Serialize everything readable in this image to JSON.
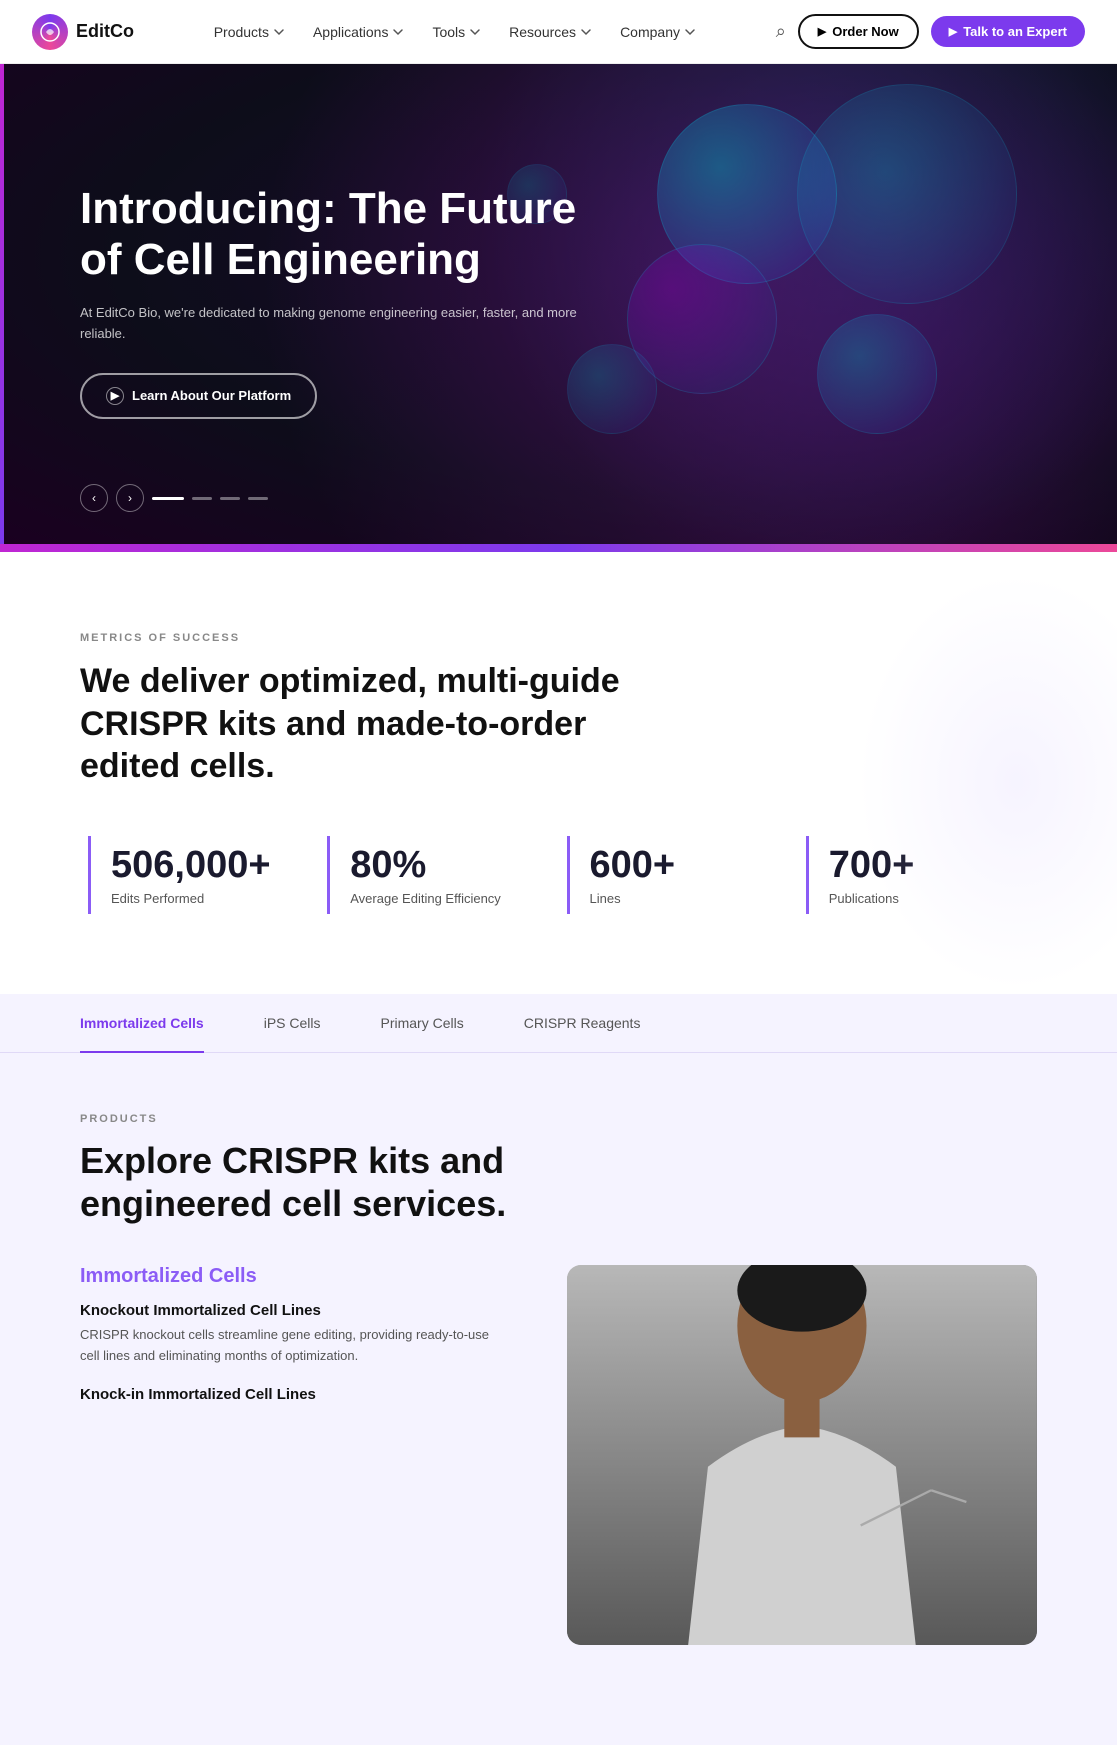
{
  "nav": {
    "logo_text": "EditCo",
    "links": [
      {
        "label": "Products",
        "has_dropdown": true
      },
      {
        "label": "Applications",
        "has_dropdown": true
      },
      {
        "label": "Tools",
        "has_dropdown": true
      },
      {
        "label": "Resources",
        "has_dropdown": true
      },
      {
        "label": "Company",
        "has_dropdown": true
      }
    ],
    "btn_order": "Order Now",
    "btn_expert": "Talk to an Expert"
  },
  "hero": {
    "title": "Introducing: The Future of Cell Engineering",
    "description": "At EditCo Bio, we're dedicated to making genome engineering easier, faster, and more reliable.",
    "cta_label": "Learn About Our Platform",
    "dots_count": 4
  },
  "metrics": {
    "section_label": "METRICS OF SUCCESS",
    "heading": "We deliver optimized, multi-guide CRISPR kits and made-to-order edited cells.",
    "items": [
      {
        "value": "506,000+",
        "description": "Edits Performed"
      },
      {
        "value": "80%",
        "description": "Average Editing Efficiency"
      },
      {
        "value": "600+",
        "description": "Lines"
      },
      {
        "value": "700+",
        "description": "Publications"
      }
    ]
  },
  "tabs": {
    "items": [
      {
        "label": "Immortalized Cells",
        "active": true
      },
      {
        "label": "iPS Cells",
        "active": false
      },
      {
        "label": "Primary Cells",
        "active": false
      },
      {
        "label": "CRISPR Reagents",
        "active": false
      }
    ]
  },
  "products": {
    "section_label": "PRODUCTS",
    "heading": "Explore CRISPR kits and engineered cell services.",
    "category_title": "Immortalized Cells",
    "items": [
      {
        "title": "Knockout Immortalized Cell Lines",
        "description": "CRISPR knockout cells streamline gene editing, providing ready-to-use cell lines and eliminating months of optimization."
      },
      {
        "title": "Knock-in Immortalized Cell Lines",
        "description": ""
      }
    ]
  }
}
